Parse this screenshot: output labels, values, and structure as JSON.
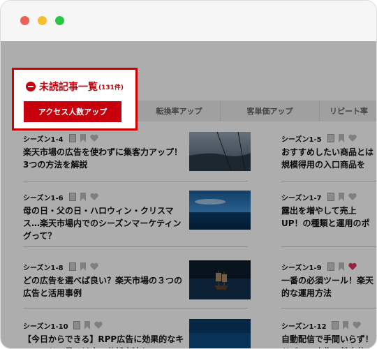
{
  "window": {
    "controls": [
      "close",
      "minimize",
      "maximize"
    ]
  },
  "section": {
    "title": "未読記事一覧",
    "count": "(131件)",
    "icon": "minus-circle-icon"
  },
  "tabs": [
    {
      "label": "アクセス人数アップ",
      "active": true
    },
    {
      "label": "転換率アップ",
      "active": false
    },
    {
      "label": "客単価アップ",
      "active": false
    },
    {
      "label": "リピート率",
      "active": false
    }
  ],
  "articles": [
    {
      "code": "シーズン1-4",
      "title": "楽天市場の広告を使わずに集客力アップ！3つの方法を解説",
      "liked": false,
      "thumb": "mountain-fog"
    },
    {
      "code": "シーズン1-5",
      "title": "おすすめしたい商品とは規模得用の入口商品を",
      "liked": false,
      "thumb": ""
    },
    {
      "code": "シーズン1-6",
      "title": "母の日・父の日・ハロウィン・クリスマス…楽天市場内でのシーズンマーケティングって？",
      "liked": false,
      "thumb": "sea-horizon"
    },
    {
      "code": "シーズン1-7",
      "title": "露出を増やして売上UP！の種類と運用のポイント",
      "liked": false,
      "thumb": ""
    },
    {
      "code": "シーズン1-8",
      "title": "どの広告を選べば良い？楽天市場の３つの広告と活用事例",
      "liked": false,
      "thumb": "sailing-ship"
    },
    {
      "code": "シーズン1-9",
      "title": "一番の必須ツール！楽天的な運用方法",
      "liked": true,
      "thumb": ""
    },
    {
      "code": "シーズン1-10",
      "title": "【今日からできる】RPP広告に効果的なキーワードの見つけ方・分析方法を",
      "liked": false,
      "thumb": "ocean-deep"
    },
    {
      "code": "シーズン1-12",
      "title": "自動配信で手間いらず！ドバンス広告の基本的な",
      "liked": false,
      "thumb": ""
    }
  ],
  "colors": {
    "accent": "#c8000b",
    "highlight_border": "#d10000",
    "heart_active": "#e0325a"
  }
}
